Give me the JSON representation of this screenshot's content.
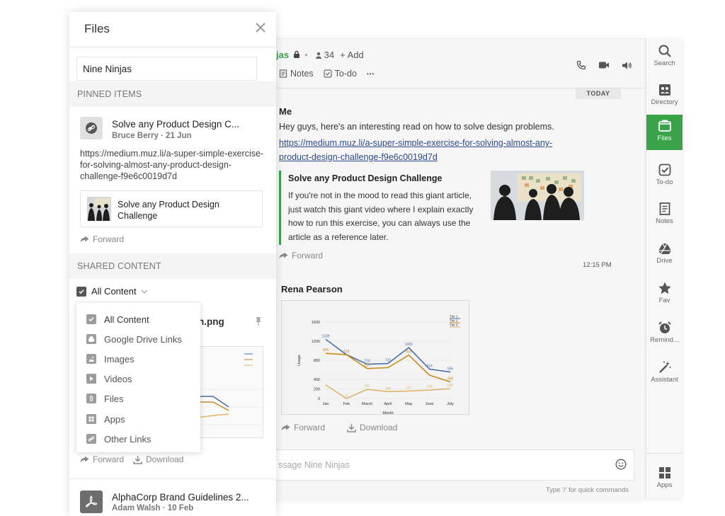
{
  "room": {
    "name": "jas",
    "member_count": "34",
    "add_label": "+ Add",
    "tabs": [
      "Notes",
      "To-do"
    ],
    "more": "•••"
  },
  "chat": {
    "today_label": "TODAY",
    "msg1": {
      "sender": "Me",
      "text": "Hey guys, here's an interesting read on how to solve design problems.",
      "link": "https://medium.muz.li/a-super-simple-exercise-for-solving-almost-any-product-design-challenge-f9e6c0019d7d",
      "preview_title": "Solve any Product Design Challenge",
      "preview_body": "If you're not in the mood to read this giant article, just watch this giant video where I explain exactly how to run this exercise, you can always use the article as a reference later.",
      "forward_label": "Forward",
      "time": "12:15 PM"
    },
    "msg2": {
      "sender": "Rena Pearson",
      "forward_label": "Forward",
      "download_label": "Download"
    },
    "composer_placeholder": "ssage Nine Ninjas",
    "hint": "Type '/' for quick commands"
  },
  "chart_data": {
    "type": "line",
    "categories": [
      "Jan",
      "Feb",
      "March",
      "April",
      "May",
      "June",
      "July"
    ],
    "series": [
      {
        "name": "Tier 1",
        "values": [
          1239,
          918,
          718,
          733,
          1065,
          614,
          555
        ],
        "color": "#4a6fa5"
      },
      {
        "name": "Tier 2",
        "values": [
          945,
          918,
          627,
          646,
          909,
          488,
          349
        ],
        "color": "#c98a1e"
      },
      {
        "name": "Tier 3",
        "values": [
          285,
          1,
          191,
          144,
          157,
          176,
          205
        ],
        "color": "#e0b36a"
      }
    ],
    "data_labels": {
      "Tier 1": [
        "1239",
        "",
        "718",
        "733",
        "1065",
        "614",
        "555"
      ],
      "Tier 2": [
        "945",
        "918",
        "627",
        "",
        "909",
        "",
        "349"
      ],
      "Tier 3": [
        "",
        "1",
        "191",
        "144",
        "157",
        "176",
        "205"
      ]
    },
    "xlabel": "Month",
    "ylabel": "Usage",
    "ylim": [
      0,
      1600
    ],
    "yticks": [
      "0",
      "200",
      "400",
      "800",
      "1200",
      "1600"
    ],
    "legend_position": "top-right",
    "grid": true
  },
  "sidebar": {
    "items": [
      {
        "label": "Search",
        "icon": "search-icon"
      },
      {
        "label": "Directory",
        "icon": "directory-icon"
      },
      {
        "label": "Files",
        "icon": "files-icon"
      },
      {
        "label": "To-do",
        "icon": "todo-icon"
      },
      {
        "label": "Notes",
        "icon": "notes-icon"
      },
      {
        "label": "Drive",
        "icon": "drive-icon"
      },
      {
        "label": "Fav",
        "icon": "star-icon"
      },
      {
        "label": "Remind...",
        "icon": "alarm-icon"
      },
      {
        "label": "Assistant",
        "icon": "wand-icon"
      },
      {
        "label": "Apps",
        "icon": "apps-icon"
      }
    ],
    "active_color": "#3aa349"
  },
  "files": {
    "title": "Files",
    "search_value": "Nine Ninjas",
    "pinned_label": "PINNED ITEMS",
    "pinned": {
      "title": "Solve any Product Design C...",
      "meta": "Bruce Berry · 21 Jun",
      "url": "https://medium.muz.li/a-super-simple-exercise-for-solving-almost-any-product-design-challenge-f9e6c0019d7d",
      "card_title": "Solve any Product Design Challenge",
      "forward_label": "Forward"
    },
    "shared_label": "SHARED CONTENT",
    "filter_label": "All Content",
    "bg_file_name": "n.png",
    "bg_forward": "Forward",
    "bg_download": "Download",
    "dropdown": [
      "All Content",
      "Google Drive Links",
      "Images",
      "Videos",
      "Files",
      "Apps",
      "Other Links"
    ],
    "file2": {
      "title": "AlphaCorp Brand Guidelines 2...",
      "meta": "Adam Walsh · 10 Feb"
    }
  },
  "colors": {
    "accent": "#3aa349",
    "link": "#2d4b8c"
  }
}
